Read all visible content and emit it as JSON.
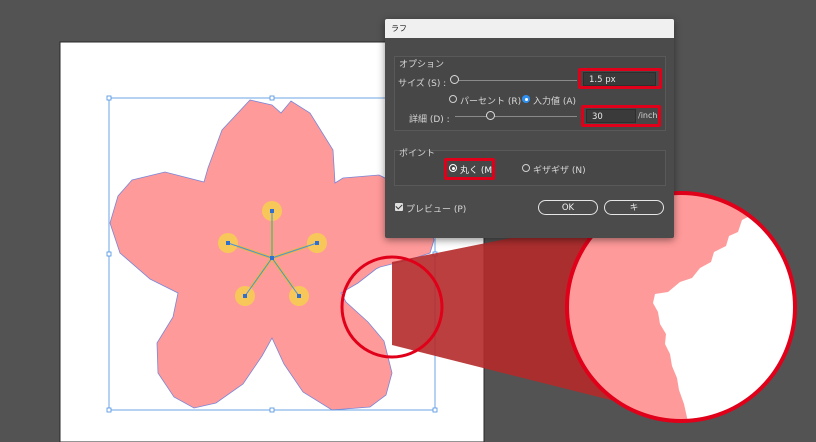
{
  "dialog": {
    "title": "ラフ",
    "options_group": "オプション",
    "size_label": "サイズ (S) :",
    "size_value": "1.5 px",
    "size_percent_label": "パーセント (R)",
    "size_absolute_label": "入力値 (A)",
    "size_mode_selected": "入力値 (A)",
    "detail_label": "詳細 (D) :",
    "detail_value": "30",
    "detail_unit": "/inch",
    "points_group": "ポイント",
    "point_smooth_label": "丸く (M",
    "point_corner_label": "ギザギザ (N)",
    "point_selected": "丸く (M",
    "preview_label": "プレビュー (P)",
    "preview_checked": true,
    "ok_label": "OK",
    "cancel_label": "キ"
  },
  "colors": {
    "workspace": "#535353",
    "artboard": "#ffffff",
    "petal": "#ff9a9a",
    "stamen": "#f7c75a",
    "selection": "#4a90e2",
    "highlight": "#e0001a",
    "callout": "#b52a2a"
  }
}
